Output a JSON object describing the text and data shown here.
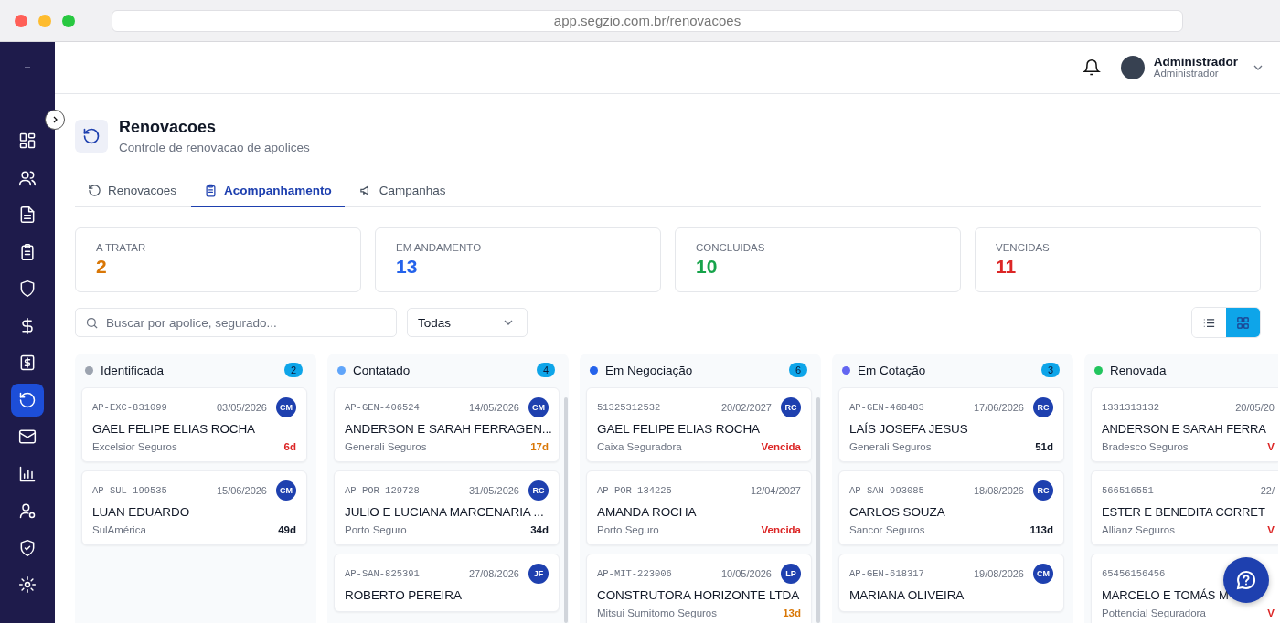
{
  "browser": {
    "url": "app.segzio.com.br/renovacoes"
  },
  "sidebar": {
    "items": [
      {
        "selected": false
      },
      {
        "selected": false
      },
      {
        "selected": false
      },
      {
        "selected": false
      },
      {
        "selected": false
      },
      {
        "selected": false
      },
      {
        "selected": false
      },
      {
        "selected": true
      },
      {
        "selected": false
      },
      {
        "selected": false
      },
      {
        "selected": false
      },
      {
        "selected": false
      },
      {
        "selected": false
      }
    ]
  },
  "user": {
    "name": "Administrador",
    "role": "Administrador"
  },
  "page": {
    "title": "Renovacoes",
    "subtitle": "Controle de renovacao de apolices"
  },
  "tabs": [
    {
      "label": "Renovacoes",
      "selected": false
    },
    {
      "label": "Acompanhamento",
      "selected": true
    },
    {
      "label": "Campanhas",
      "selected": false
    }
  ],
  "stats": [
    {
      "label": "A TRATAR",
      "value": "2",
      "color": "#d97706"
    },
    {
      "label": "EM ANDAMENTO",
      "value": "13",
      "color": "#2563eb"
    },
    {
      "label": "CONCLUIDAS",
      "value": "10",
      "color": "#16a34a"
    },
    {
      "label": "VENCIDAS",
      "value": "11",
      "color": "#dc2626"
    }
  ],
  "search": {
    "placeholder": "Buscar por apolice, segurado..."
  },
  "filter": {
    "value": "Todas"
  },
  "view_toggle": [
    {
      "selected": false
    },
    {
      "selected": true
    }
  ],
  "columns": [
    {
      "title": "Identificada",
      "count": "2",
      "color": "#9ca3af",
      "cards": [
        {
          "policy": "AP-EXC-831099",
          "date": "03/05/2026",
          "initials": "CM",
          "name": "GAEL FELIPE ELIAS ROCHA",
          "insurer": "Excelsior Seguros",
          "days": "6d",
          "color": "#dc2626"
        },
        {
          "policy": "AP-SUL-199535",
          "date": "15/06/2026",
          "initials": "CM",
          "name": "LUAN EDUARDO",
          "insurer": "SulAmérica",
          "days": "49d",
          "color": "#111827"
        }
      ]
    },
    {
      "title": "Contatado",
      "count": "4",
      "color": "#60a5fa",
      "cards": [
        {
          "policy": "AP-GEN-406524",
          "date": "14/05/2026",
          "initials": "CM",
          "name": "ANDERSON E SARAH FERRAGEN...",
          "insurer": "Generali Seguros",
          "days": "17d",
          "color": "#d97706"
        },
        {
          "policy": "AP-POR-129728",
          "date": "31/05/2026",
          "initials": "RC",
          "name": "JULIO E LUCIANA MARCENARIA ...",
          "insurer": "Porto Seguro",
          "days": "34d",
          "color": "#111827"
        },
        {
          "policy": "AP-SAN-825391",
          "date": "27/08/2026",
          "initials": "JF",
          "name": "ROBERTO PEREIRA"
        }
      ]
    },
    {
      "title": "Em Negociação",
      "count": "6",
      "color": "#2563eb",
      "cards": [
        {
          "policy": "51325312532",
          "date": "20/02/2027",
          "initials": "RC",
          "name": "GAEL FELIPE ELIAS ROCHA",
          "insurer": "Caixa Seguradora",
          "days": "Vencida",
          "color": "#dc2626"
        },
        {
          "policy": "AP-POR-134225",
          "date": "12/04/2027",
          "name": "AMANDA ROCHA",
          "insurer": "Porto Seguro",
          "days": "Vencida",
          "color": "#dc2626"
        },
        {
          "policy": "AP-MIT-223006",
          "date": "10/05/2026",
          "initials": "LP",
          "name": "CONSTRUTORA HORIZONTE LTDA",
          "insurer": "Mitsui Sumitomo Seguros",
          "days": "13d",
          "color": "#d97706"
        }
      ]
    },
    {
      "title": "Em Cotação",
      "count": "3",
      "color": "#6366f1",
      "cards": [
        {
          "policy": "AP-GEN-468483",
          "date": "17/06/2026",
          "initials": "RC",
          "name": "LAÍS JOSEFA JESUS",
          "insurer": "Generali Seguros",
          "days": "51d",
          "color": "#111827"
        },
        {
          "policy": "AP-SAN-993085",
          "date": "18/08/2026",
          "initials": "RC",
          "name": "CARLOS SOUZA",
          "insurer": "Sancor Seguros",
          "days": "113d",
          "color": "#111827"
        },
        {
          "policy": "AP-GEN-618317",
          "date": "19/08/2026",
          "initials": "CM",
          "name": "MARIANA OLIVEIRA"
        }
      ]
    },
    {
      "title": "Renovada",
      "color": "#22c55e",
      "cards": [
        {
          "policy": "1331313132",
          "date": "20/05/20",
          "name": "ANDERSON E SARAH FERRA",
          "insurer": "Bradesco Seguros",
          "days": "V",
          "color": "#dc2626"
        },
        {
          "policy": "566516551",
          "date": "22/",
          "name": "ESTER E BENEDITA CORRET",
          "insurer": "Allianz Seguros",
          "days": "V",
          "color": "#dc2626"
        },
        {
          "policy": "65456156456",
          "name": "MARCELO E TOMÁS M",
          "insurer": "Pottencial Seguradora",
          "days": "V",
          "color": "#dc2626"
        }
      ]
    }
  ]
}
